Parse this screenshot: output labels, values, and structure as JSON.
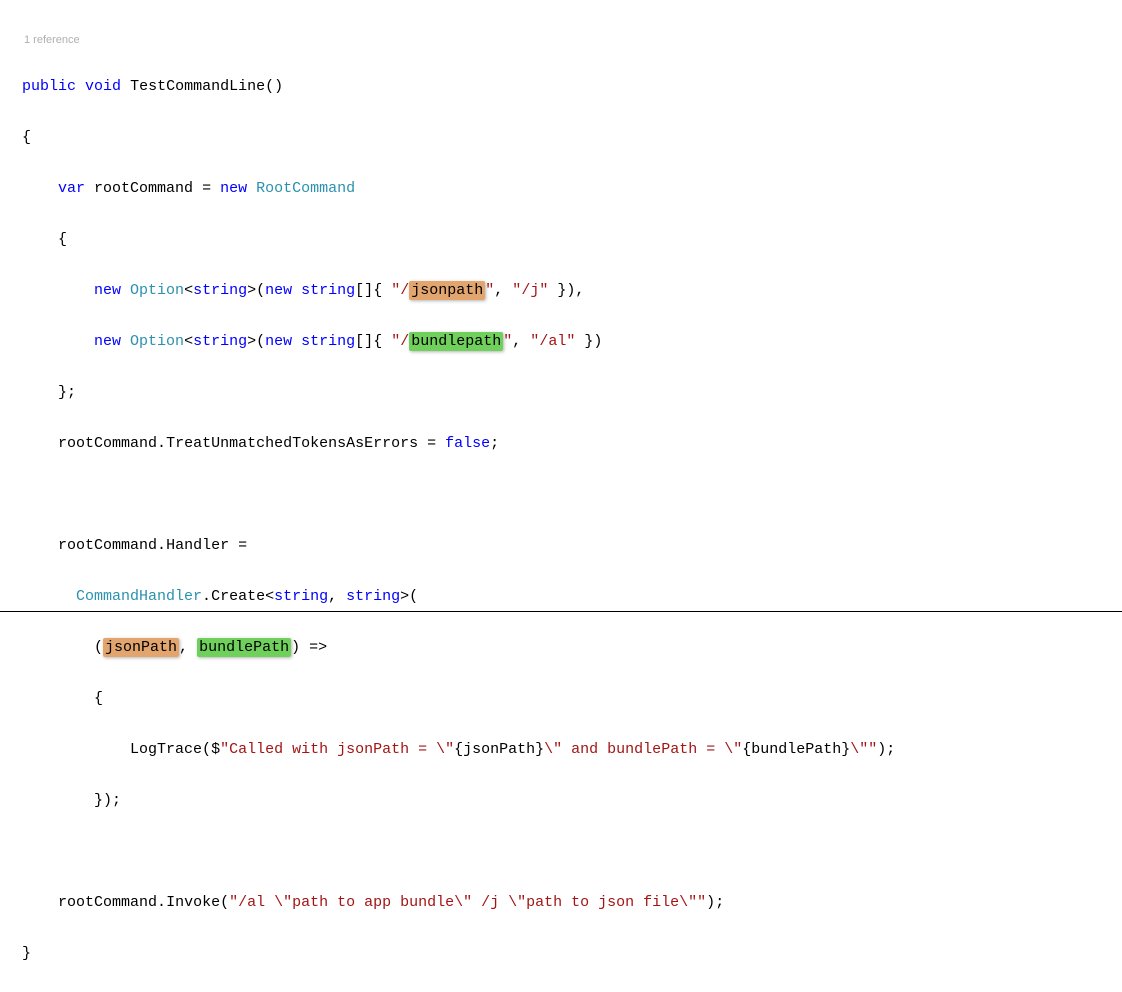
{
  "codelens": {
    "ref": "1 reference"
  },
  "tokens": {
    "public": "public",
    "void": "void",
    "method": "TestCommandLine",
    "var": "var",
    "rootCommand": "rootCommand",
    "eq": "=",
    "new": "new",
    "RootCommand": "RootCommand",
    "Option": "Option",
    "string": "string",
    "jsonpath": "jsonpath",
    "j": "/j",
    "bundlepath": "bundlepath",
    "al": "/al",
    "TreatUnmatched": "TreatUnmatchedTokensAsErrors",
    "false": "false",
    "Handler": "Handler",
    "CommandHandler": "CommandHandler",
    "Create": "Create",
    "jsonPath": "jsonPath",
    "bundlePath": "bundlePath",
    "arrow": "=>",
    "LogTrace": "LogTrace",
    "logStr1": "\"Called with jsonPath = ",
    "esc": "\\\"",
    "interp1": "{jsonPath}",
    "logStr2": " and bundlePath = ",
    "interp2": "{bundlePath}",
    "Invoke": "Invoke",
    "invokeArg": "\"/al \\\"path to app bundle\\\" /j \\\"path to json file\\\"\"",
    "lbrace": "{",
    "rbrace": "}",
    "lparen": "(",
    "rparen": ")",
    "lbracket": "[",
    "rbracket": "]",
    "semi": ";",
    "comma": ",",
    "dot": ".",
    "lt": "<",
    "gt": ">",
    "dollar": "$",
    "quote": "\"",
    "slash": "/",
    "closeq": "\""
  }
}
